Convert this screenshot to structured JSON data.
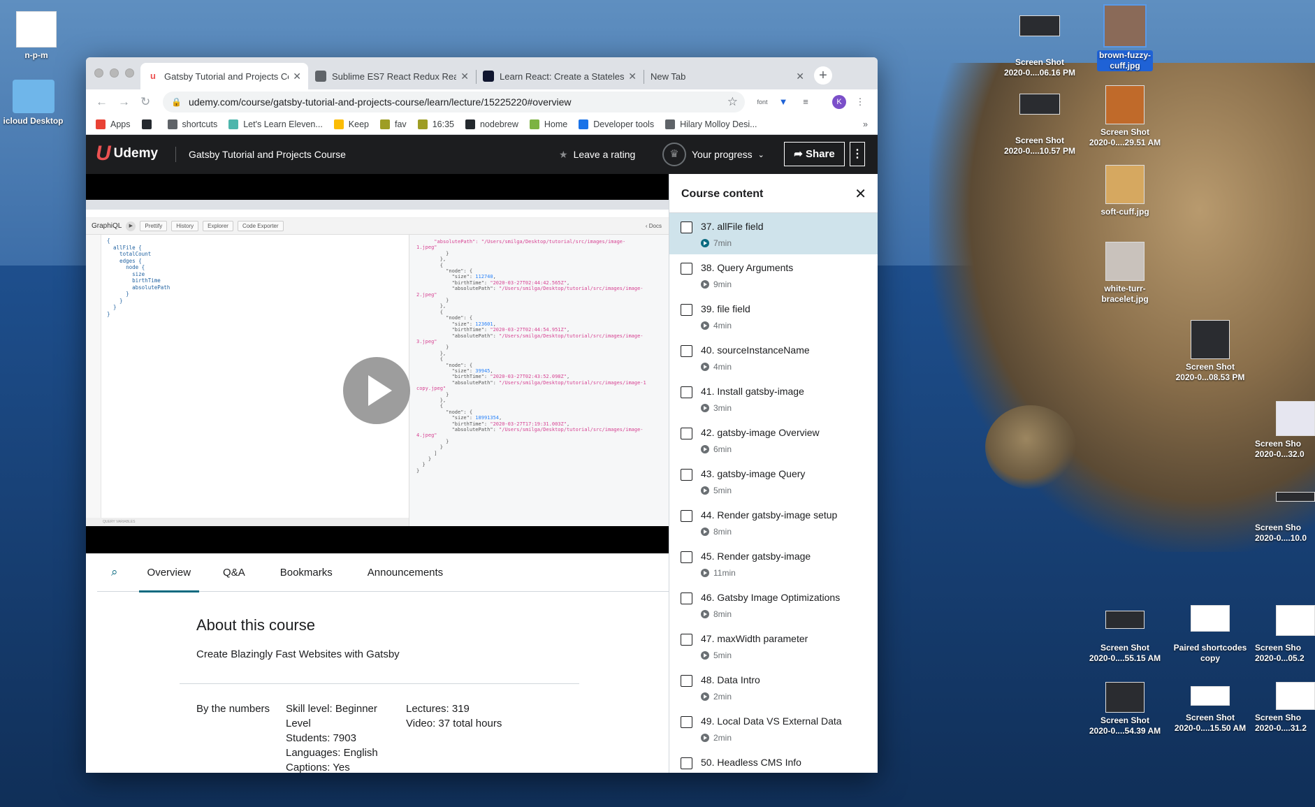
{
  "desktop": {
    "icons": [
      {
        "id": "npm",
        "label": "n-p-m"
      },
      {
        "id": "icloud",
        "label": "icloud Desktop"
      },
      {
        "id": "ss1",
        "label": "Screen Shot\n2020-0....06.16 PM"
      },
      {
        "id": "brown",
        "label": "brown-fuzzy-\ncuff.jpg"
      },
      {
        "id": "ss2",
        "label": "Screen Shot\n2020-0....10.57 PM"
      },
      {
        "id": "ss3",
        "label": "Screen Shot\n2020-0....29.51 AM"
      },
      {
        "id": "soft",
        "label": "soft-cuff.jpg"
      },
      {
        "id": "white",
        "label": "white-turr-\nbracelet.jpg"
      },
      {
        "id": "ss4",
        "label": "Screen Shot\n2020-0...08.53 PM"
      },
      {
        "id": "ss5",
        "label": "Screen Sho\n2020-0...32.0"
      },
      {
        "id": "ss6",
        "label": "Screen Sho\n2020-0....10.0"
      },
      {
        "id": "ss7",
        "label": "Screen Shot\n2020-0....55.15 AM"
      },
      {
        "id": "paired",
        "label": "Paired shortcodes\ncopy"
      },
      {
        "id": "ss8",
        "label": "Screen Sho\n2020-0...05.2"
      },
      {
        "id": "ss9",
        "label": "Screen Shot\n2020-0....54.39 AM"
      },
      {
        "id": "ss10",
        "label": "Screen Shot\n2020-0....15.50 AM"
      },
      {
        "id": "ss11",
        "label": "Screen Sho\n2020-0....31.2"
      }
    ]
  },
  "browser": {
    "tabs": [
      {
        "title": "Gatsby Tutorial and Projects Co",
        "favicon": "udemy-icon",
        "active": true
      },
      {
        "title": "Sublime ES7 React Redux Reac",
        "favicon": "sublime-icon",
        "active": false
      },
      {
        "title": "Learn React: Create a Stateles",
        "favicon": "codecademy-icon",
        "active": false
      },
      {
        "title": "New Tab",
        "favicon": "",
        "active": false
      }
    ],
    "new_tab": "+",
    "url": "udemy.com/course/gatsby-tutorial-and-projects-course/learn/lecture/15225220#overview",
    "profile_initial": "K",
    "font_ext": "font",
    "bookmarks": [
      {
        "label": "Apps",
        "color": "#e94235"
      },
      {
        "label": "",
        "color": "#24292e"
      },
      {
        "label": "shortcuts",
        "color": "#5f6368"
      },
      {
        "label": "Let's Learn Eleven...",
        "color": "#4db6ac"
      },
      {
        "label": "Keep",
        "color": "#fbbc04"
      },
      {
        "label": "fav",
        "color": "#9e9d24"
      },
      {
        "label": "16:35",
        "color": "#9e9d24"
      },
      {
        "label": "nodebrew",
        "color": "#24292e"
      },
      {
        "label": "Home",
        "color": "#7cb342"
      },
      {
        "label": "Developer tools",
        "color": "#1a73e8"
      },
      {
        "label": "Hilary Molloy Desi...",
        "color": "#5f6368"
      }
    ],
    "more": "»"
  },
  "udemy": {
    "logo": "Udemy",
    "course_title": "Gatsby Tutorial and Projects Course",
    "leave_rating": "Leave a rating",
    "your_progress": "Your progress",
    "share": "Share",
    "tabs": [
      "Overview",
      "Q&A",
      "Bookmarks",
      "Announcements"
    ],
    "about_title": "About this course",
    "about_sub": "Create Blazingly Fast Websites with Gatsby",
    "numbers_label": "By the numbers",
    "numbers_col1": [
      "Skill level: Beginner",
      "Level",
      "Students: 7903",
      "Languages: English",
      "Captions: Yes"
    ],
    "numbers_col2": [
      "Lectures: 319",
      "Video: 37 total hours"
    ]
  },
  "video": {
    "graphiql_title": "GraphiQL",
    "buttons": [
      "Prettify",
      "History",
      "Explorer",
      "Code Exporter"
    ],
    "docs": "‹ Docs",
    "query": "{\n  allFile {\n    totalCount\n    edges {\n      node {\n        size\n        birthTime\n        absolutePath\n      }\n    }\n  }\n}",
    "query_variables": "QUERY VARIABLES"
  },
  "course_content": {
    "title": "Course content",
    "items": [
      {
        "title": "37. allFile field",
        "duration": "7min",
        "current": true
      },
      {
        "title": "38. Query Arguments",
        "duration": "9min"
      },
      {
        "title": "39. file field",
        "duration": "4min"
      },
      {
        "title": "40. sourceInstanceName",
        "duration": "4min"
      },
      {
        "title": "41. Install gatsby-image",
        "duration": "3min"
      },
      {
        "title": "42. gatsby-image Overview",
        "duration": "6min"
      },
      {
        "title": "43. gatsby-image Query",
        "duration": "5min"
      },
      {
        "title": "44. Render gatsby-image setup",
        "duration": "8min"
      },
      {
        "title": "45. Render gatsby-image",
        "duration": "11min"
      },
      {
        "title": "46. Gatsby Image Optimizations",
        "duration": "8min"
      },
      {
        "title": "47. maxWidth parameter",
        "duration": "5min"
      },
      {
        "title": "48. Data Intro",
        "duration": "2min"
      },
      {
        "title": "49. Local Data VS External Data",
        "duration": "2min"
      },
      {
        "title": "50. Headless CMS Info",
        "duration": ""
      }
    ]
  }
}
